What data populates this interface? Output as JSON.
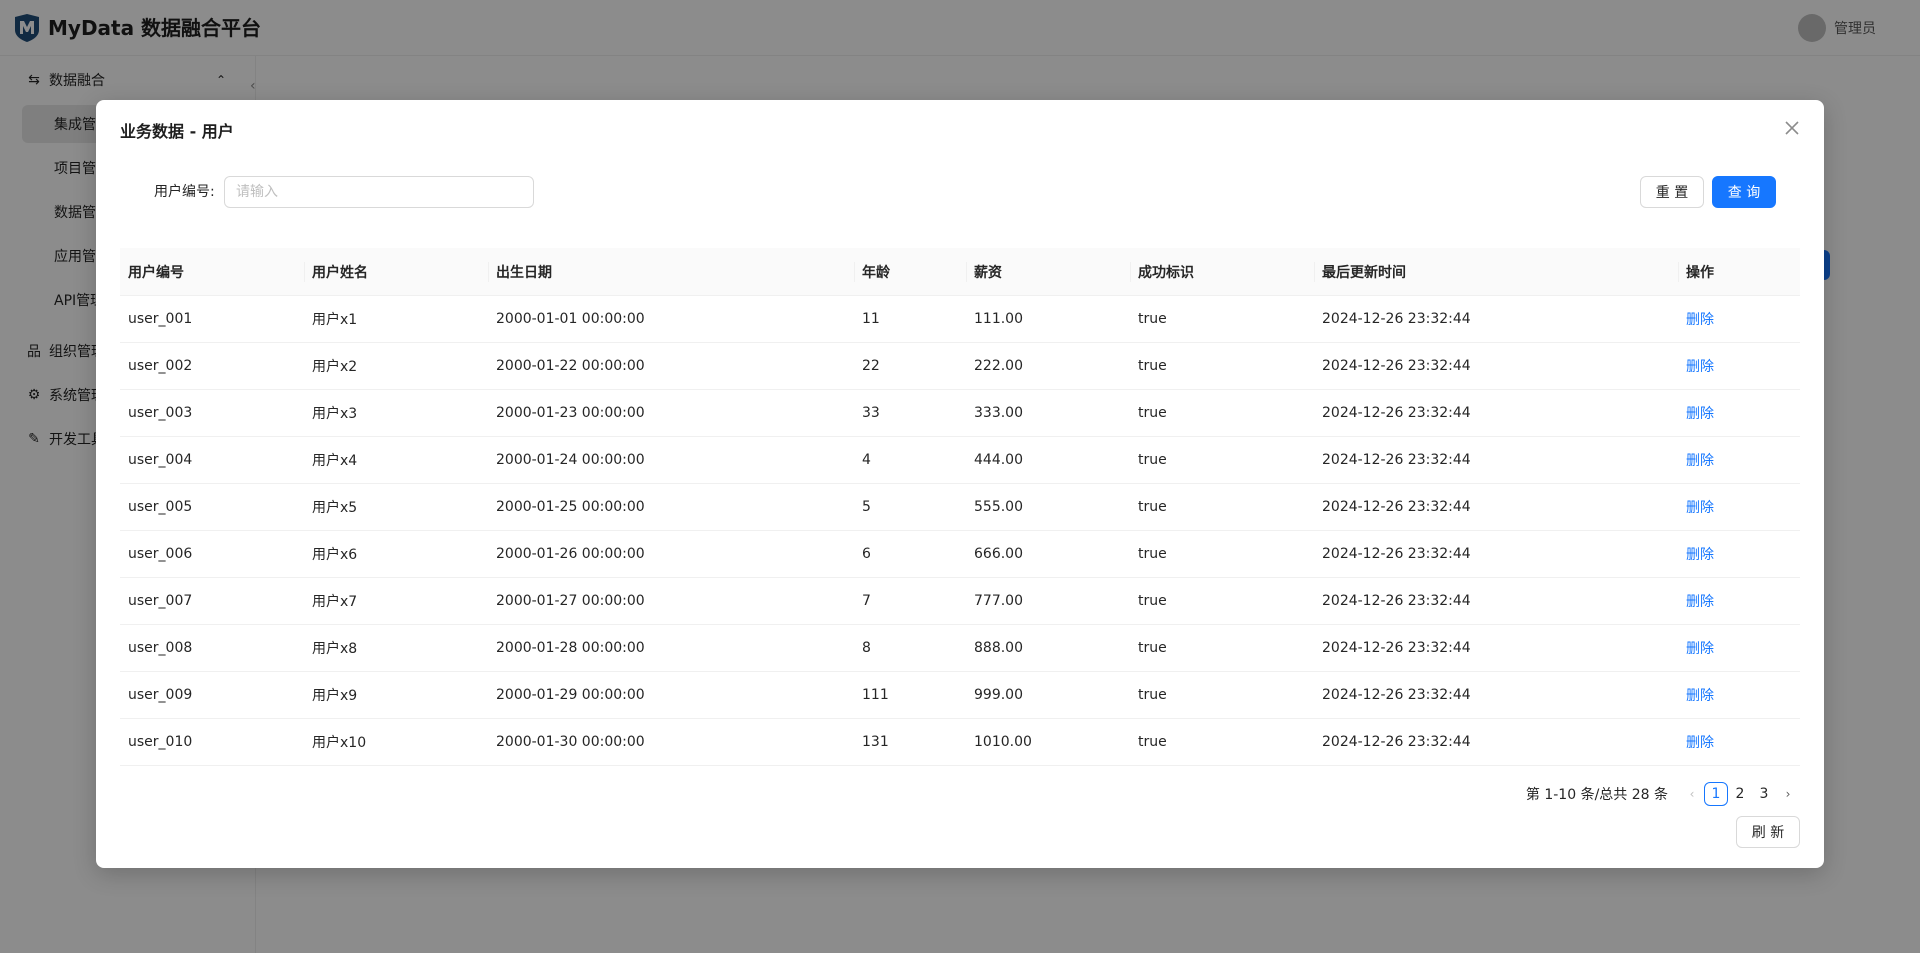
{
  "app": {
    "title": "MyData 数据融合平台",
    "user_name": "管理员"
  },
  "sidebar": {
    "groups": [
      {
        "label": "数据融合",
        "icon": "swap-icon"
      },
      {
        "label": "组织管理",
        "icon": "org-icon"
      },
      {
        "label": "系统管理",
        "icon": "gear-icon"
      },
      {
        "label": "开发工具",
        "icon": "tool-icon"
      }
    ],
    "sub_items": [
      {
        "label": "集成管理"
      },
      {
        "label": "项目管理"
      },
      {
        "label": "数据管理"
      },
      {
        "label": "应用管理"
      },
      {
        "label": "API管理"
      }
    ]
  },
  "modal": {
    "title": "业务数据 - 用户",
    "search": {
      "label": "用户编号:",
      "placeholder": "请输入"
    },
    "buttons": {
      "reset": "重 置",
      "query": "查 询",
      "refresh": "刷 新"
    },
    "table": {
      "columns": [
        "用户编号",
        "用户姓名",
        "出生日期",
        "年龄",
        "薪资",
        "成功标识",
        "最后更新时间",
        "操作"
      ],
      "rows": [
        [
          "user_001",
          "用户x1",
          "2000-01-01 00:00:00",
          "11",
          "111.00",
          "true",
          "2024-12-26 23:32:44",
          "删除"
        ],
        [
          "user_002",
          "用户x2",
          "2000-01-22 00:00:00",
          "22",
          "222.00",
          "true",
          "2024-12-26 23:32:44",
          "删除"
        ],
        [
          "user_003",
          "用户x3",
          "2000-01-23 00:00:00",
          "33",
          "333.00",
          "true",
          "2024-12-26 23:32:44",
          "删除"
        ],
        [
          "user_004",
          "用户x4",
          "2000-01-24 00:00:00",
          "4",
          "444.00",
          "true",
          "2024-12-26 23:32:44",
          "删除"
        ],
        [
          "user_005",
          "用户x5",
          "2000-01-25 00:00:00",
          "5",
          "555.00",
          "true",
          "2024-12-26 23:32:44",
          "删除"
        ],
        [
          "user_006",
          "用户x6",
          "2000-01-26 00:00:00",
          "6",
          "666.00",
          "true",
          "2024-12-26 23:32:44",
          "删除"
        ],
        [
          "user_007",
          "用户x7",
          "2000-01-27 00:00:00",
          "7",
          "777.00",
          "true",
          "2024-12-26 23:32:44",
          "删除"
        ],
        [
          "user_008",
          "用户x8",
          "2000-01-28 00:00:00",
          "8",
          "888.00",
          "true",
          "2024-12-26 23:32:44",
          "删除"
        ],
        [
          "user_009",
          "用户x9",
          "2000-01-29 00:00:00",
          "111",
          "999.00",
          "true",
          "2024-12-26 23:32:44",
          "删除"
        ],
        [
          "user_010",
          "用户x10",
          "2000-01-30 00:00:00",
          "131",
          "1010.00",
          "true",
          "2024-12-26 23:32:44",
          "删除"
        ]
      ]
    },
    "pagination": {
      "total_text": "第 1-10 条/总共 28 条",
      "pages": [
        "1",
        "2",
        "3"
      ],
      "current": "1"
    }
  },
  "colors": {
    "primary": "#1677ff",
    "overlay": "rgba(0,0,0,0.45)",
    "logo": "#1f4e79"
  }
}
